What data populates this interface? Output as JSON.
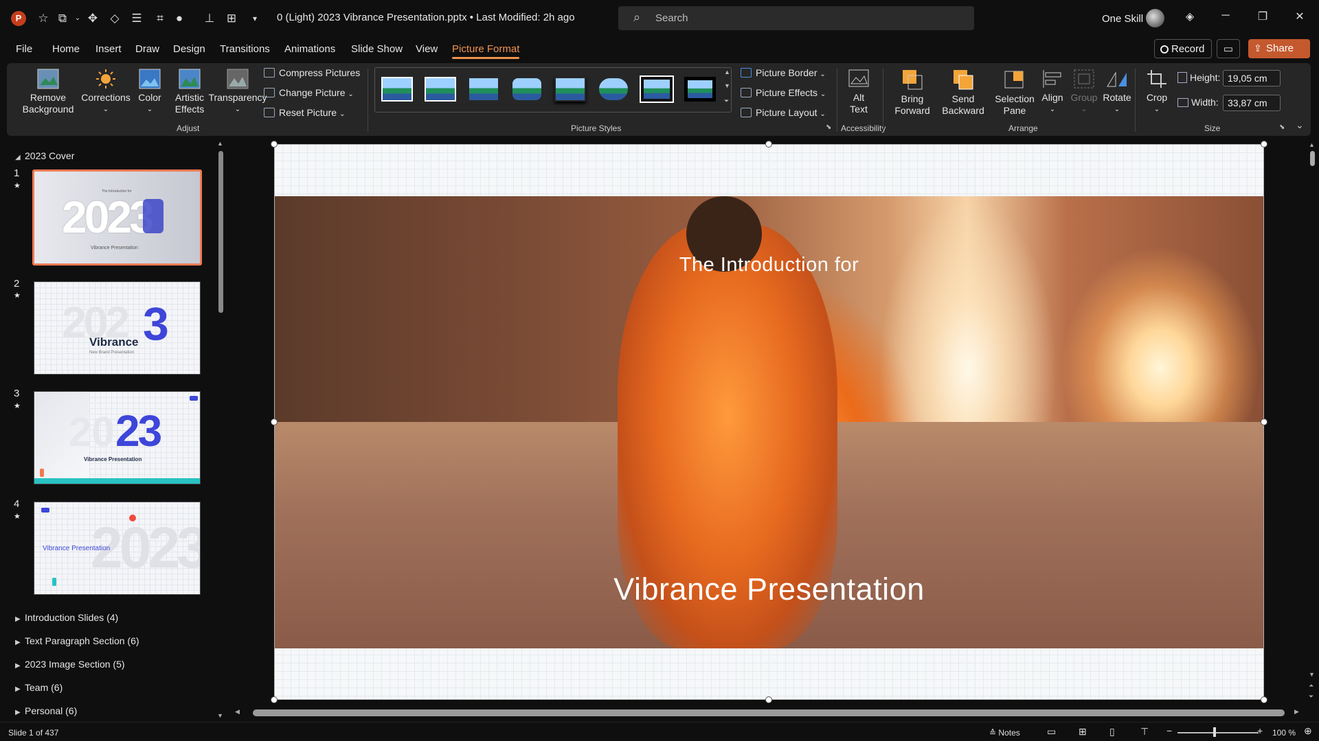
{
  "app": {
    "name": "PowerPoint",
    "doc_title": "0 (Light) 2023 Vibrance Presentation.pptx • Last Modified: 2h ago"
  },
  "search": {
    "placeholder": "Search"
  },
  "user": {
    "name": "One Skill"
  },
  "menu": {
    "tabs": [
      "File",
      "Home",
      "Insert",
      "Draw",
      "Design",
      "Transitions",
      "Animations",
      "Slide Show",
      "View",
      "Picture Format"
    ],
    "active": "Picture Format"
  },
  "actions": {
    "record": "Record",
    "share": "Share"
  },
  "ribbon": {
    "adjust": {
      "group": "Adjust",
      "remove_background": [
        "Remove",
        "Background"
      ],
      "corrections": "Corrections",
      "color": "Color",
      "artistic_effects": [
        "Artistic",
        "Effects"
      ],
      "transparency": "Transparency",
      "compress": "Compress Pictures",
      "change": "Change Picture",
      "reset": "Reset Picture"
    },
    "styles": {
      "group": "Picture Styles",
      "border": "Picture Border",
      "effects": "Picture Effects",
      "layout": "Picture Layout"
    },
    "accessibility": {
      "group": "Accessibility",
      "alt_text": [
        "Alt",
        "Text"
      ]
    },
    "arrange": {
      "group": "Arrange",
      "bring_forward": [
        "Bring",
        "Forward"
      ],
      "send_backward": [
        "Send",
        "Backward"
      ],
      "selection_pane": [
        "Selection",
        "Pane"
      ],
      "align": "Align",
      "group_btn": "Group",
      "rotate": "Rotate"
    },
    "size": {
      "group": "Size",
      "crop": "Crop",
      "height_label": "Height:",
      "height_value": "19,05 cm",
      "width_label": "Width:",
      "width_value": "33,87 cm"
    }
  },
  "panel": {
    "section_top": "2023 Cover",
    "slides": [
      {
        "num": "1",
        "big": "2023",
        "sub": "Vibrance Presentation",
        "small": "The Introduction for"
      },
      {
        "num": "2",
        "big": "3",
        "brand": "Vibrance",
        "sub": "New Brand Presentation"
      },
      {
        "num": "3",
        "big": "23",
        "sub": "Vibrance Presentation"
      },
      {
        "num": "4",
        "big": "2023",
        "sub": "Vibrance Presentation"
      }
    ],
    "sections": [
      "Introduction Slides (4)",
      "Text Paragraph Section (6)",
      "2023 Image Section (5)",
      "Team (6)",
      "Personal (6)"
    ]
  },
  "slide": {
    "intro": "The Introduction for",
    "title": "Vibrance Presentation"
  },
  "status": {
    "slide_info": "Slide 1 of 437",
    "notes": "Notes",
    "zoom": "100 %"
  },
  "colors": {
    "accent": "#f0934f",
    "share": "#c4592e",
    "selected_thumb": "#f07a52"
  }
}
